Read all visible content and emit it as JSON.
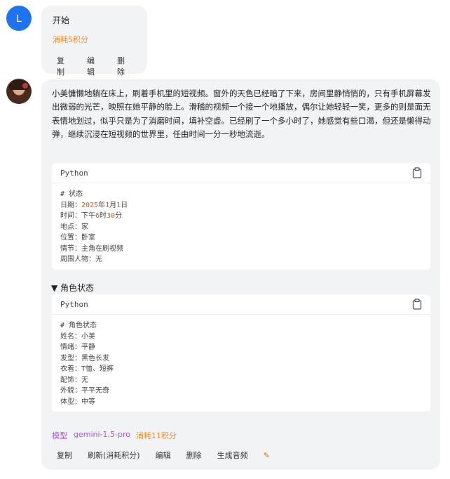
{
  "user": {
    "avatar_letter": "L",
    "message": "开始",
    "cost": "消耗5积分",
    "actions": [
      "复制",
      "编辑",
      "删除"
    ]
  },
  "assistant": {
    "story": "小美慵懒地躺在床上，刷着手机里的短视频。窗外的天色已经暗了下来，房间里静悄悄的，只有手机屏幕发出微弱的光芒，映照在她平静的脸上。滑稽的视频一个接一个地播放，偶尔让她轻轻一笑，更多的则是面无表情地划过，似乎只是为了消磨时间，填补空虚。已经刷了一个多小时了，她感觉有些口渴，但还是懒得动弹，继续沉浸在短视频的世界里，任由时间一分一秒地流逝。",
    "code_blocks": [
      {
        "language": "Python",
        "lines": [
          "# 状态",
          "日期：2025年1月1日",
          "时间：下午6时30分",
          "地点：家",
          "位置：卧室",
          "情节：主角在刷视频",
          "周围人物：无"
        ]
      },
      {
        "language": "Python",
        "lines": [
          "# 角色状态",
          "姓名：小美",
          "情绪：平静",
          "发型：黑色长发",
          "衣着：T恤、短裤",
          "配饰：无",
          "外貌：平平无奇",
          "体型：中等"
        ]
      }
    ],
    "toggle_label": "▼ 角色状态",
    "model_label": "模型",
    "model_name": "gemini-1.5-pro",
    "cost": "消耗11积分",
    "actions": [
      "复制",
      "刷新(消耗积分)",
      "编辑",
      "删除",
      "生成音频"
    ],
    "audio_icon": "pencil-icon"
  },
  "colors": {
    "user_avatar": "#1e74f0",
    "bubble_bg": "#f2f3f5",
    "cost_orange": "#f08a24",
    "model_purple": "#a35ad6"
  }
}
